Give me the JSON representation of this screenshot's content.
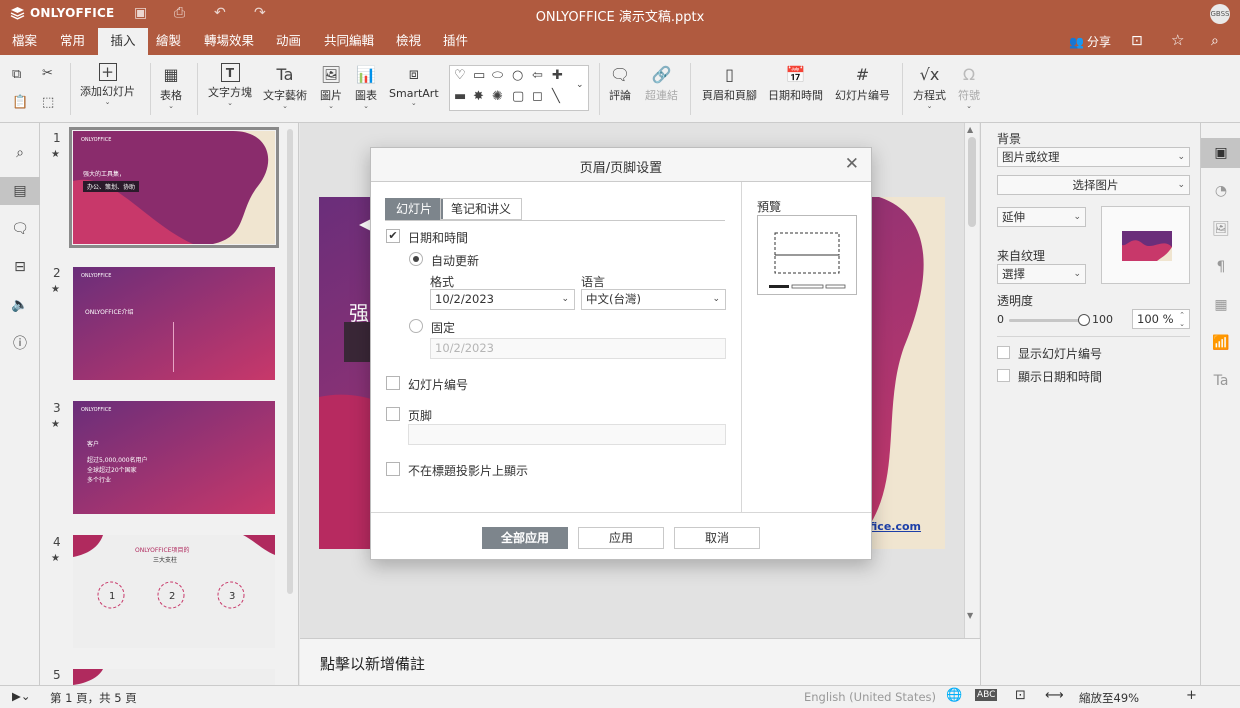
{
  "app": {
    "logo_text": "ONLYOFFICE",
    "doc_title": "ONLYOFFICE 演示文稿.pptx",
    "user_initials": "GBSS"
  },
  "menu": {
    "tabs": [
      "檔案",
      "常用",
      "插入",
      "繪製",
      "轉場效果",
      "动画",
      "共同編輯",
      "檢視",
      "插件"
    ],
    "active": "插入",
    "share_label": "分享"
  },
  "toolbar": {
    "add_slide": "添加幻灯片",
    "table": "表格",
    "textbox": "文字方塊",
    "textart": "文字藝術",
    "image": "圖片",
    "chart": "圖表",
    "smartart": "SmartArt",
    "comment": "評論",
    "hyperlink": "超連結",
    "header_footer": "頁眉和頁腳",
    "datetime": "日期和時間",
    "slide_number": "幻灯片编号",
    "equation": "方程式",
    "symbol": "符號"
  },
  "thumbnails": [
    {
      "number": "1",
      "lines": [
        "强大的工具集，",
        "办公、策划、协助"
      ]
    },
    {
      "number": "2",
      "lines": [
        "ONLYOFFICE介绍"
      ]
    },
    {
      "number": "3",
      "lines": [
        "客户",
        "超过5,000,000名用户",
        "全球超过20个国家",
        "多个行业"
      ]
    },
    {
      "number": "4",
      "lines": [
        "ONLYOFFICE项目的",
        "三大支柱"
      ]
    },
    {
      "number": "5",
      "lines": []
    }
  ],
  "slide": {
    "text_fragment": "强",
    "link_fragment": "fice.com"
  },
  "notes_placeholder": "點擊以新增備註",
  "right_panel": {
    "background_label": "背景",
    "fill_type": "图片或纹理",
    "select_image": "选择图片",
    "stretch": "延伸",
    "from_texture_label": "来自纹理",
    "select_texture": "選擇",
    "transparency_label": "透明度",
    "transparency_min": "0",
    "transparency_max": "100",
    "transparency_value": "100 %",
    "show_slide_number": "显示幻灯片编号",
    "show_datetime": "顯示日期和時間"
  },
  "status": {
    "page_info": "第 1 頁，共 5 頁",
    "language": "English (United States)",
    "zoom": "縮放至49%"
  },
  "dialog": {
    "title": "页眉/页脚设置",
    "tabs": [
      "幻灯片",
      "笔记和讲义"
    ],
    "active_tab": "幻灯片",
    "datetime_label": "日期和時間",
    "datetime_checked": true,
    "auto_update_label": "自动更新",
    "auto_update_selected": true,
    "format_label": "格式",
    "format_value": "10/2/2023",
    "language_label": "语言",
    "language_value": "中文(台灣)",
    "fixed_label": "固定",
    "fixed_value": "10/2/2023",
    "slide_number_label": "幻灯片编号",
    "slide_number_checked": false,
    "footer_label": "页脚",
    "footer_checked": false,
    "footer_value": "",
    "hide_title_label": "不在標題投影片上顯示",
    "hide_title_checked": false,
    "preview_label": "預覽",
    "apply_all": "全部应用",
    "apply": "应用",
    "cancel": "取消"
  },
  "colors": {
    "brand": "#b05a3f",
    "slide_magenta": "#b02a5e",
    "slide_purple": "#6a2e7a",
    "slide_cream": "#f0e5d0",
    "button_primary": "#7d858c"
  }
}
